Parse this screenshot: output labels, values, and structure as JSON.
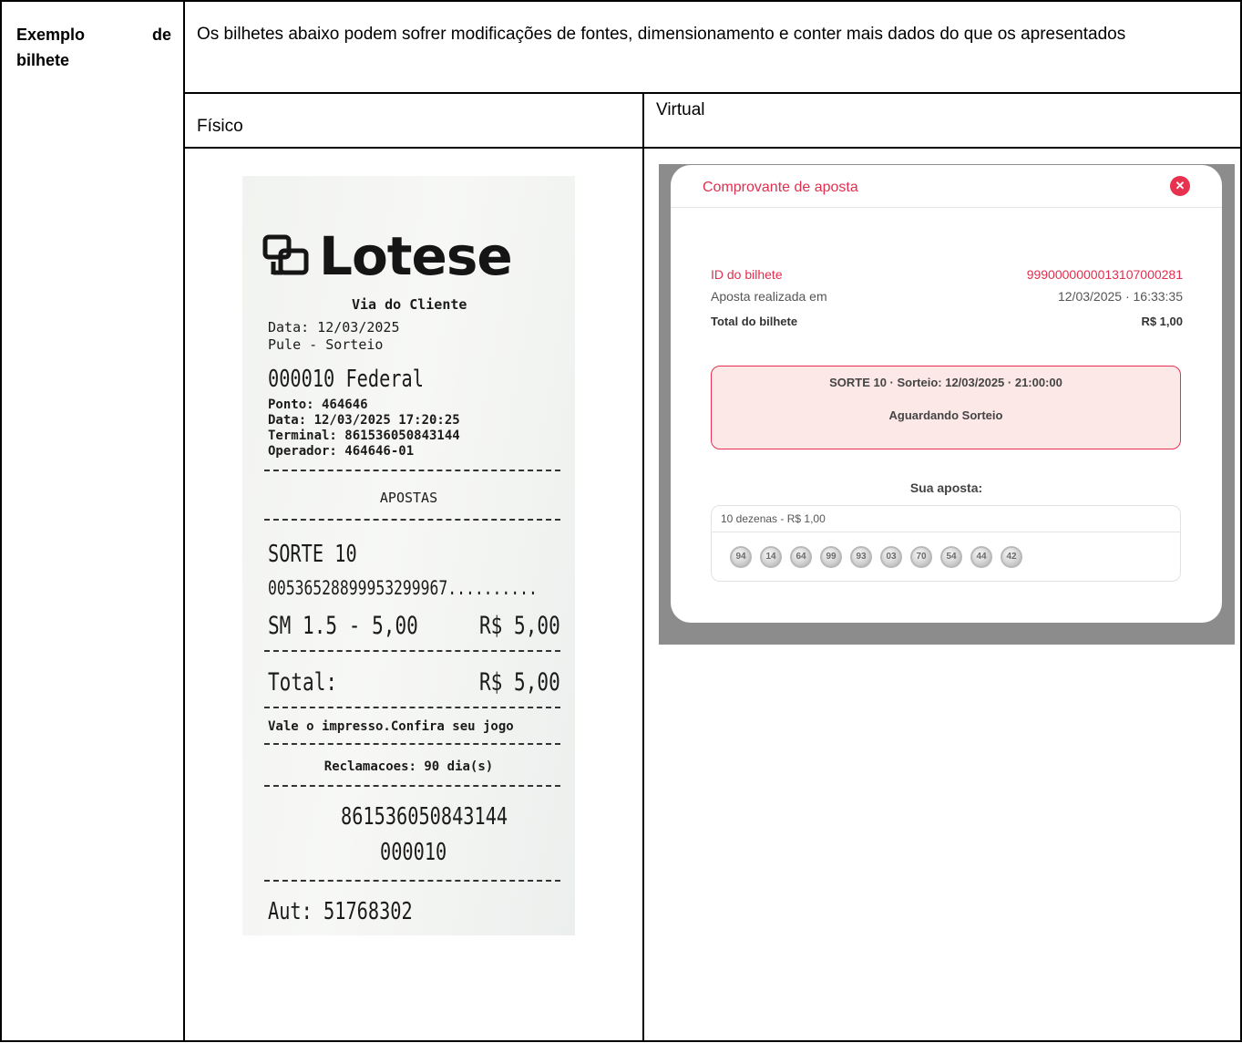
{
  "label": {
    "word1": "Exemplo",
    "word2": "de",
    "word3": "bilhete"
  },
  "intro": "Os bilhetes abaixo podem sofrer modificações de fontes, dimensionamento e conter mais dados do que os apresentados",
  "columns": {
    "fisico": "Físico",
    "virtual": "Virtual"
  },
  "receipt": {
    "logo_text": "Lotese",
    "logo_icon": "lotese-logo-icon",
    "tagline": "Via do Cliente",
    "date": "Data: 12/03/2025",
    "pule": "Pule - Sorteio",
    "federal": "000010 Federal",
    "ponto": "Ponto: 464646",
    "data_hora": "Data: 12/03/2025 17:20:25",
    "terminal": "Terminal: 861536050843144",
    "operador": "Operador: 464646-01",
    "apostas": "APOSTAS",
    "game": "SORTE 10",
    "numbers": "00536528899953299967..........",
    "line_left": "SM 1.5 - 5,00",
    "line_right": "R$ 5,00",
    "total_label": "Total:",
    "total_value": "R$ 5,00",
    "vale": "Vale o impresso.Confira seu jogo",
    "reclamacoes": "Reclamacoes: 90 dia(s)",
    "code1": "861536050843144",
    "code2": "000010",
    "aut": "Aut: 51768302"
  },
  "modal": {
    "title": "Comprovante de aposta",
    "close_icon": "close-icon",
    "close_glyph": "✕",
    "ticket_id_label": "ID do bilhete",
    "ticket_id_value": "9990000000013107000281",
    "placed_label": "Aposta realizada em",
    "placed_value": "12/03/2025 · 16:33:35",
    "total_label": "Total do bilhete",
    "total_value": "R$ 1,00",
    "status_line1": "SORTE 10 · Sorteio: 12/03/2025 · 21:00:00",
    "status_line2": "Aguardando Sorteio",
    "your_bet": "Sua aposta:",
    "bet_title": "10 dezenas - R$ 1,00",
    "balls": [
      "94",
      "14",
      "64",
      "99",
      "93",
      "03",
      "70",
      "54",
      "44",
      "42"
    ]
  },
  "colors": {
    "accent": "#e0304f",
    "status_bg": "#fde8e8",
    "border": "#000000"
  }
}
